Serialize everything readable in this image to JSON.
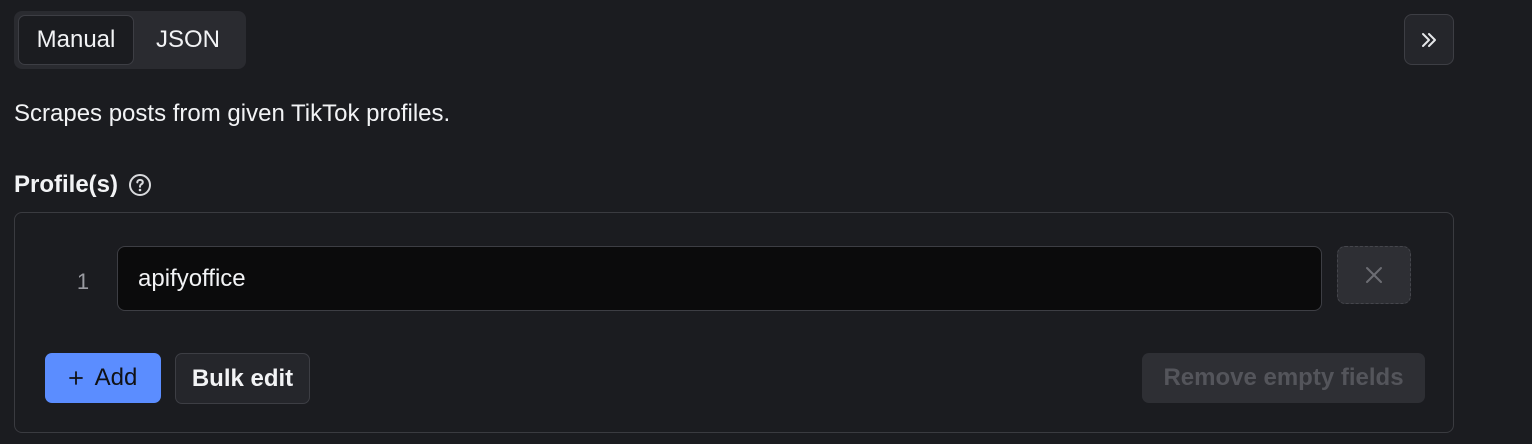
{
  "mode_toggle": {
    "manual_label": "Manual",
    "json_label": "JSON",
    "active": "Manual"
  },
  "collapse_icon": "double-chevron-right-icon",
  "description": "Scrapes posts from given TikTok profiles.",
  "field": {
    "label": "Profile(s)",
    "help_icon": "question-circle-icon",
    "rows": [
      {
        "index": "1",
        "value": "apifyoffice"
      }
    ],
    "remove_row_icon": "close-icon"
  },
  "actions": {
    "add_label": "Add",
    "add_icon": "plus-icon",
    "bulk_edit_label": "Bulk edit",
    "remove_empty_label": "Remove empty fields"
  },
  "colors": {
    "background": "#1b1c20",
    "accent": "#5b8dff",
    "text": "#f2f3f5",
    "muted_text": "#9a9ba1",
    "disabled_text": "#54555b"
  }
}
